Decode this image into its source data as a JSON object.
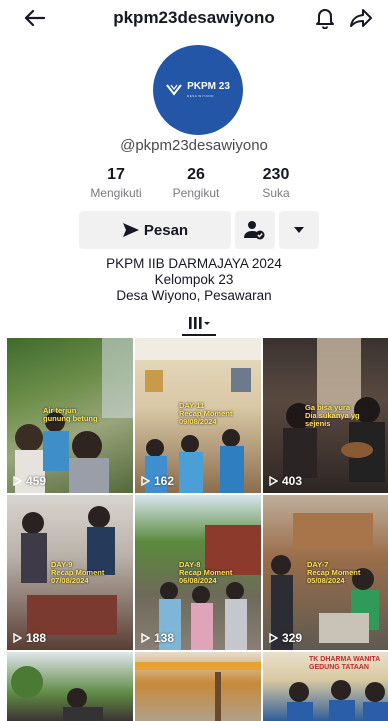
{
  "header": {
    "title": "pkpm23desawiyono",
    "icons": {
      "back": "back-arrow-icon",
      "bell": "bell-icon",
      "share": "share-icon"
    }
  },
  "profile": {
    "avatar_text": "PKPM 23",
    "avatar_subtext": "DESA WIYONO",
    "handle": "@pkpm23desawiyono",
    "stats": [
      {
        "value": "17",
        "label": "Mengikuti"
      },
      {
        "value": "26",
        "label": "Pengikut"
      },
      {
        "value": "230",
        "label": "Suka"
      }
    ],
    "message_label": "Pesan",
    "bio": [
      "PKPM IIB DARMAJAYA 2024",
      "Kelompok 23",
      "Desa Wiyono, Pesawaran"
    ]
  },
  "colors": {
    "accent_blue": "#2456a8",
    "button_bg": "#f1f1f2",
    "caption_yellow": "#ffe45c"
  },
  "videos": [
    {
      "views": "459",
      "caption": "Air terjun\ngunung betung"
    },
    {
      "views": "162",
      "caption": "DAY-11\nRecap Moment\n09/08/2024"
    },
    {
      "views": "403",
      "caption": "Ga bisa yura\nDia sukanya yg\nsejenis"
    },
    {
      "views": "188",
      "caption": "DAY-9\nRecap Moment\n07/08/2024"
    },
    {
      "views": "138",
      "caption": "DAY-8\nRecap Moment\n06/08/2024"
    },
    {
      "views": "329",
      "caption": "DAY-7\nRecap Moment\n05/08/2024"
    },
    {
      "views": "",
      "caption": ""
    },
    {
      "views": "",
      "caption": ""
    },
    {
      "views": "",
      "caption": "TK DHARMA WANITA\nGEDUNG TATAAN"
    }
  ]
}
